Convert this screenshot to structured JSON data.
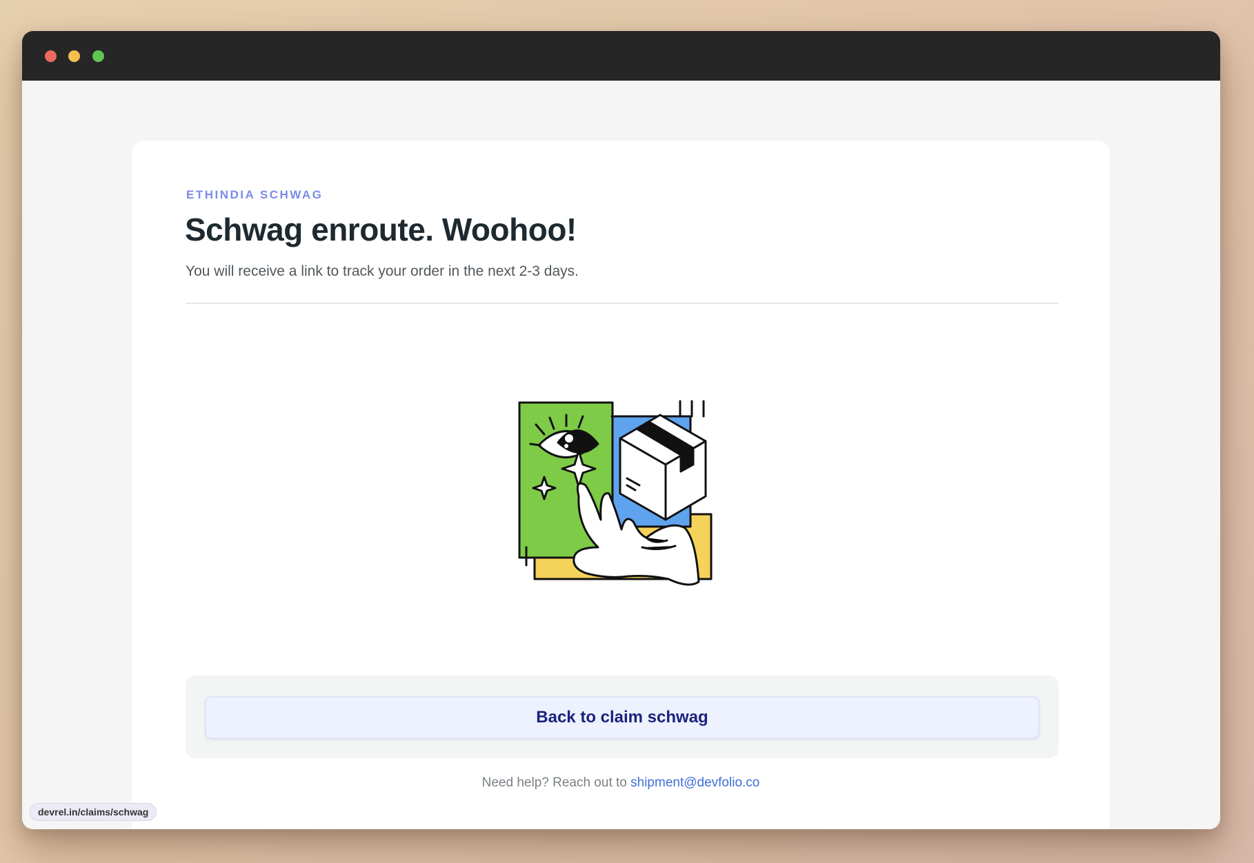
{
  "window": {
    "controls": [
      "close",
      "minimize",
      "maximize"
    ]
  },
  "page": {
    "eyebrow": "ETHINDIA SCHWAG",
    "title": "Schwag enroute. Woohoo!",
    "subtitle": "You will receive a link to track your order in the next 2-3 days.",
    "illustration": "hand-holding-package-illustration",
    "cta_label": "Back to claim schwag",
    "help_prefix": "Need help? Reach out to",
    "help_email": "shipment@devfolio.co"
  },
  "status_bar": {
    "url": "devrel.in/claims/schwag"
  },
  "colors": {
    "accent": "#7b8ae8",
    "button_text": "#1a237e",
    "link": "#3f6fd8",
    "illustration_green": "#7ecb47",
    "illustration_blue": "#5fa3ee",
    "illustration_yellow": "#f5d35a"
  }
}
